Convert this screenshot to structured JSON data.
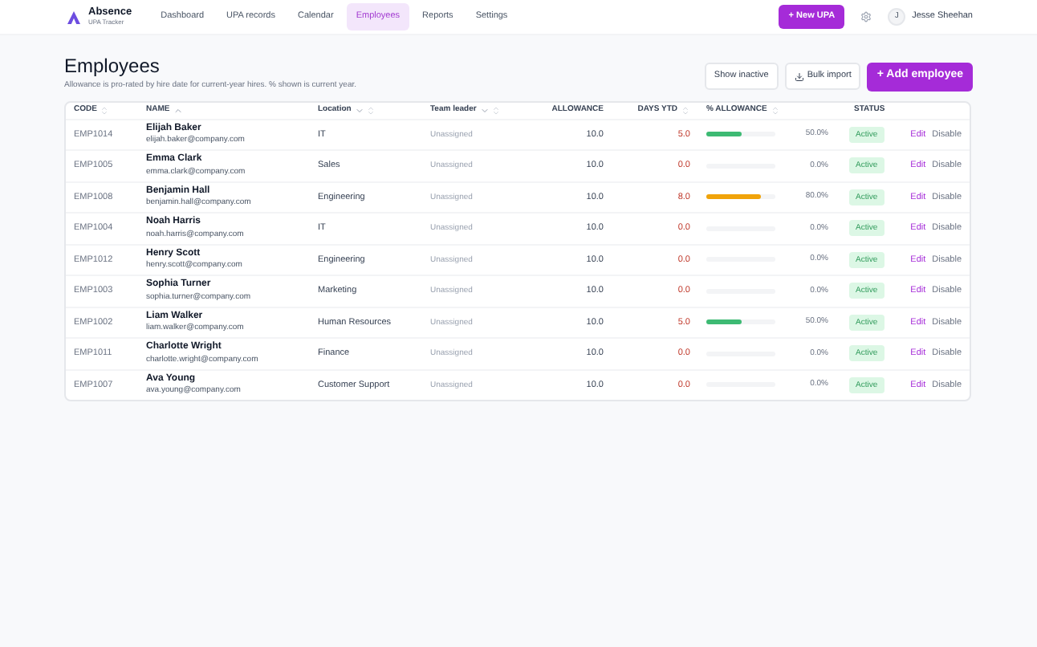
{
  "brand": {
    "name": "Absence",
    "subtitle": "UPA Tracker"
  },
  "nav": [
    {
      "label": "Dashboard",
      "selected": false
    },
    {
      "label": "UPA records",
      "selected": false
    },
    {
      "label": "Calendar",
      "selected": false
    },
    {
      "label": "Employees",
      "selected": true
    },
    {
      "label": "Reports",
      "selected": false
    },
    {
      "label": "Settings",
      "selected": false
    }
  ],
  "new_button": "+ New UPA",
  "user": {
    "initial": "J",
    "name": "Jesse Sheehan"
  },
  "page": {
    "title": "Employees",
    "subtitle": "Allowance is pro-rated by hire date for current-year hires. % shown is current year."
  },
  "actions": {
    "show_inactive": "Show inactive",
    "bulk_import": "Bulk import",
    "add": "+ Add employee"
  },
  "table": {
    "columns": [
      {
        "label": "CODE",
        "kind": "sortable"
      },
      {
        "label": "NAME",
        "kind": "sorted"
      },
      {
        "label": "Location",
        "kind": "filterable"
      },
      {
        "label": "Team leader",
        "kind": "filterable"
      },
      {
        "label": "ALLOWANCE",
        "kind": "plain"
      },
      {
        "label": "DAYS YTD",
        "kind": "sortable"
      },
      {
        "label": "% ALLOWANCE",
        "kind": "sortable"
      },
      {
        "label": "STATUS",
        "kind": "plain"
      }
    ],
    "rows": [
      {
        "code": "EMP1014",
        "name": "Elijah Baker",
        "email": "elijah.baker@company.com",
        "location": "IT",
        "leader": "Unassigned",
        "allowance": "10.0",
        "days": "5.0",
        "level": 0.5,
        "pct": "50.0%",
        "status": "Active",
        "edit": "Edit",
        "disable": "Disable"
      },
      {
        "code": "EMP1005",
        "name": "Emma Clark",
        "email": "emma.clark@company.com",
        "location": "Sales",
        "leader": "Unassigned",
        "allowance": "10.0",
        "days": "0.0",
        "level": 0,
        "pct": "0.0%",
        "status": "Active",
        "edit": "Edit",
        "disable": "Disable"
      },
      {
        "code": "EMP1008",
        "name": "Benjamin Hall",
        "email": "benjamin.hall@company.com",
        "location": "Engineering",
        "leader": "Unassigned",
        "allowance": "10.0",
        "days": "8.0",
        "level": 0.8,
        "pct": "80.0%",
        "status": "Active",
        "edit": "Edit",
        "disable": "Disable"
      },
      {
        "code": "EMP1004",
        "name": "Noah Harris",
        "email": "noah.harris@company.com",
        "location": "IT",
        "leader": "Unassigned",
        "allowance": "10.0",
        "days": "0.0",
        "level": 0,
        "pct": "0.0%",
        "status": "Active",
        "edit": "Edit",
        "disable": "Disable"
      },
      {
        "code": "EMP1012",
        "name": "Henry Scott",
        "email": "henry.scott@company.com",
        "location": "Engineering",
        "leader": "Unassigned",
        "allowance": "10.0",
        "days": "0.0",
        "level": 0,
        "pct": "0.0%",
        "status": "Active",
        "edit": "Edit",
        "disable": "Disable"
      },
      {
        "code": "EMP1003",
        "name": "Sophia Turner",
        "email": "sophia.turner@company.com",
        "location": "Marketing",
        "leader": "Unassigned",
        "allowance": "10.0",
        "days": "0.0",
        "level": 0,
        "pct": "0.0%",
        "status": "Active",
        "edit": "Edit",
        "disable": "Disable"
      },
      {
        "code": "EMP1002",
        "name": "Liam Walker",
        "email": "liam.walker@company.com",
        "location": "Human Resources",
        "leader": "Unassigned",
        "allowance": "10.0",
        "days": "5.0",
        "level": 0.5,
        "pct": "50.0%",
        "status": "Active",
        "edit": "Edit",
        "disable": "Disable"
      },
      {
        "code": "EMP1011",
        "name": "Charlotte Wright",
        "email": "charlotte.wright@company.com",
        "location": "Finance",
        "leader": "Unassigned",
        "allowance": "10.0",
        "days": "0.0",
        "level": 0,
        "pct": "0.0%",
        "status": "Active",
        "edit": "Edit",
        "disable": "Disable"
      },
      {
        "code": "EMP1007",
        "name": "Ava Young",
        "email": "ava.young@company.com",
        "location": "Customer Support",
        "leader": "Unassigned",
        "allowance": "10.0",
        "days": "0.0",
        "level": 0,
        "pct": "0.0%",
        "status": "Active",
        "edit": "Edit",
        "disable": "Disable"
      }
    ]
  }
}
